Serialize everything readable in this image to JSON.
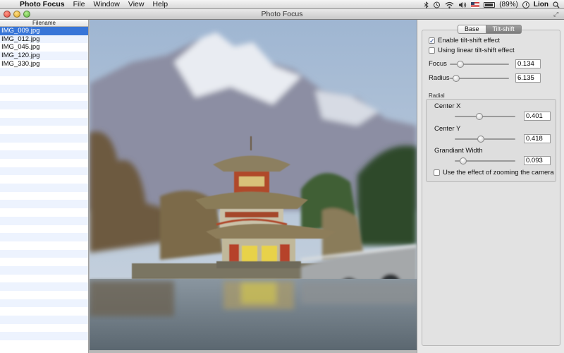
{
  "menubar": {
    "apple_glyph": "",
    "app_name": "Photo Focus",
    "menus": [
      "File",
      "Window",
      "View",
      "Help"
    ],
    "battery_text": "(89%)",
    "user": "Lion"
  },
  "window": {
    "title": "Photo Focus",
    "fullscreen_glyph": "⤢"
  },
  "filelist": {
    "header": "Filename",
    "files": [
      "IMG_009.jpg",
      "IMG_012.jpg",
      "IMG_045.jpg",
      "IMG_120.jpg",
      "IMG_330.jpg"
    ],
    "selected_index": 0
  },
  "inspector": {
    "tabs": [
      "Base",
      "Tilt-shift"
    ],
    "active_tab": 1,
    "enable_tilt": {
      "label": "Enable tilt-shift effect",
      "checked": true,
      "mark": "✓"
    },
    "linear_tilt": {
      "label": "Using linear tilt-shift effect",
      "checked": false
    },
    "focus": {
      "label": "Focus",
      "value": "0.134",
      "level": 0.134
    },
    "radius": {
      "label": "Radius",
      "value": "6.135",
      "level": 0.06
    },
    "radial_label": "Radial",
    "center_x": {
      "label": "Center X",
      "value": "0.401",
      "level": 0.401
    },
    "center_y": {
      "label": "Center Y",
      "value": "0.418",
      "level": 0.418
    },
    "gradient_width": {
      "label": "Grandiant Width",
      "value": "0.093",
      "level": 0.093
    },
    "zoom_effect": {
      "label": "Use the effect of zooming the camera",
      "checked": false
    }
  },
  "colors": {
    "selection": "#3875d7",
    "sky": "#a9bfd8",
    "mountain": "#8e8fa2",
    "roof": "#8a7a58",
    "water": "#6d7c86"
  }
}
